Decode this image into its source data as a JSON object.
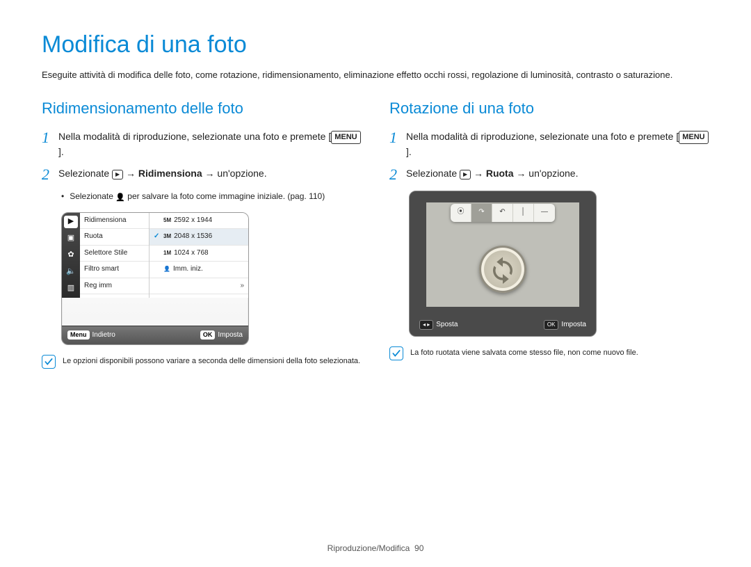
{
  "title": "Modifica di una foto",
  "intro": "Eseguite attività di modifica delle foto, come rotazione, ridimensionamento, eliminazione effetto occhi rossi, regolazione di luminosità, contrasto o saturazione.",
  "left": {
    "heading": "Ridimensionamento delle foto",
    "step1": "Nella modalità di riproduzione, selezionate una foto e premete [",
    "menu_label": "MENU",
    "step1_end": "].",
    "step2_a": "Selezionate ",
    "step2_b": " → ",
    "step2_bold": "Ridimensiona",
    "step2_c": " → un'opzione.",
    "bullet_a": "Selezionate ",
    "bullet_b": " per salvare la foto come immagine iniziale. (pag. 110)",
    "menu_items": [
      "Ridimensiona",
      "Ruota",
      "Selettore Stile",
      "Filtro smart",
      "Reg imm"
    ],
    "size_options": [
      {
        "label": "2592 x 1944",
        "icon": "5M",
        "sel": false
      },
      {
        "label": "2048 x 1536",
        "icon": "3M",
        "sel": true
      },
      {
        "label": "1024 x 768",
        "icon": "1M",
        "sel": false
      },
      {
        "label": "Imm. iniz.",
        "icon": "👤",
        "sel": false
      }
    ],
    "foot_back": "Indietro",
    "foot_back_key": "Menu",
    "foot_ok": "Imposta",
    "foot_ok_key": "OK",
    "note": "Le opzioni disponibili possono variare a seconda delle dimensioni della foto selezionata."
  },
  "right": {
    "heading": "Rotazione di una foto",
    "step1": "Nella modalità di riproduzione, selezionate una foto e premete [",
    "menu_label": "MENU",
    "step1_end": "].",
    "step2_a": "Selezionate ",
    "step2_b": " → ",
    "step2_bold": "Ruota",
    "step2_c": " → un'opzione.",
    "tb_icons": [
      "⦿",
      "↷",
      "↶",
      "│",
      "—"
    ],
    "rfoot_left_key": "◂ ▸",
    "rfoot_left": "Sposta",
    "rfoot_right_key": "OK",
    "rfoot_right": "Imposta",
    "note": "La foto ruotata viene salvata come stesso file, non come nuovo file."
  },
  "footer_section": "Riproduzione/Modifica",
  "footer_page": "90"
}
